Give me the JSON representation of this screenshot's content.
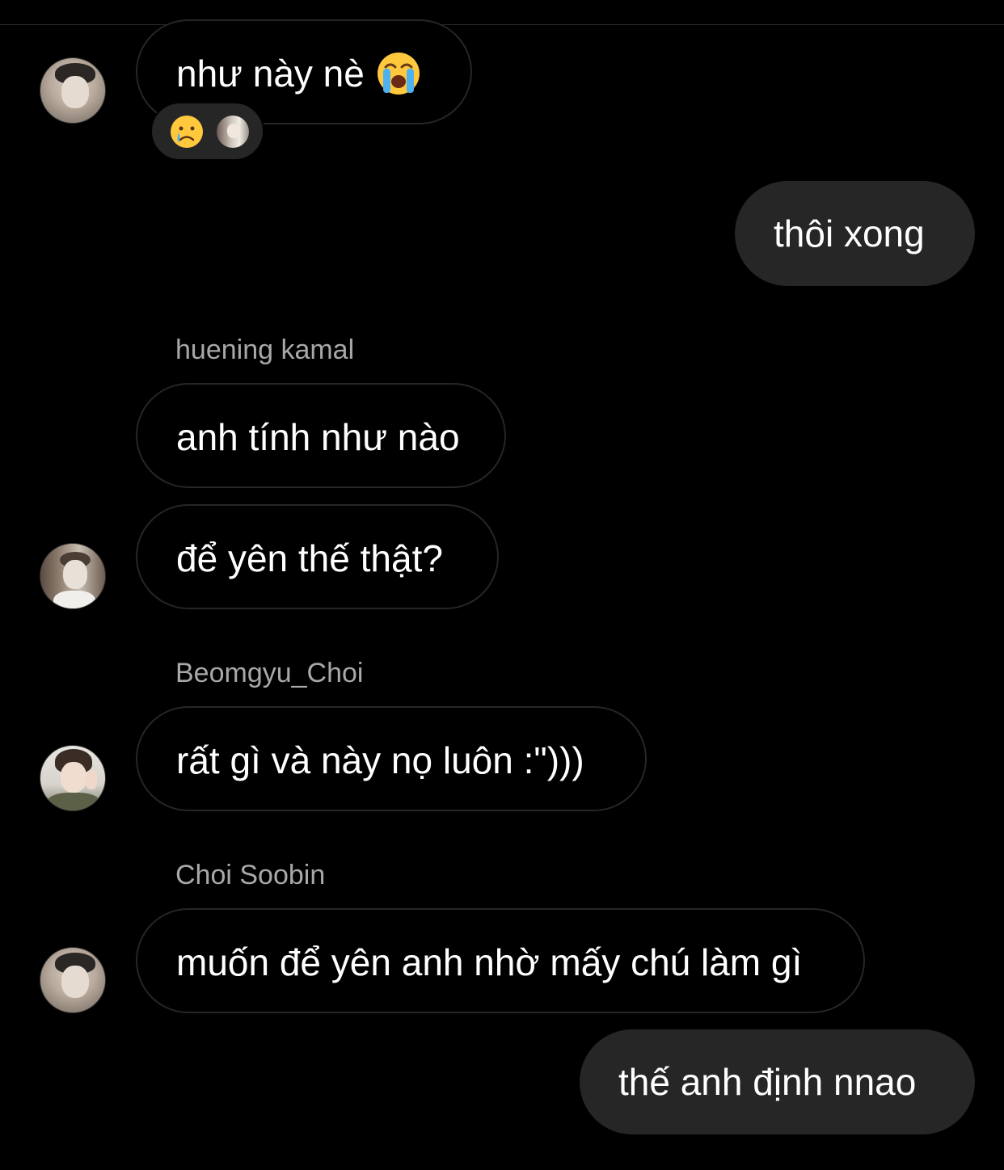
{
  "messages": [
    {
      "type": "incoming",
      "text": "như này nè",
      "emoji": "loudly-crying-face"
    },
    {
      "type": "outgoing",
      "text": "thôi xong"
    },
    {
      "type": "sender",
      "text": "huening kamal"
    },
    {
      "type": "incoming",
      "text": "anh tính như nào"
    },
    {
      "type": "incoming",
      "text": "để yên thế thật?"
    },
    {
      "type": "sender",
      "text": "Beomgyu_Choi"
    },
    {
      "type": "incoming",
      "text": "rất gì và này nọ luôn :\")))"
    },
    {
      "type": "sender",
      "text": "Choi Soobin"
    },
    {
      "type": "incoming",
      "text": "muốn để yên anh nhờ mấy chú làm gì"
    },
    {
      "type": "outgoing",
      "text": "thế anh định nnao"
    }
  ],
  "reaction": {
    "emoji": "crying-face"
  },
  "colors": {
    "background": "#000000",
    "outgoing_bubble": "#262626",
    "incoming_border": "#262626",
    "sender_name": "#a8a8a8",
    "text": "#ffffff"
  }
}
